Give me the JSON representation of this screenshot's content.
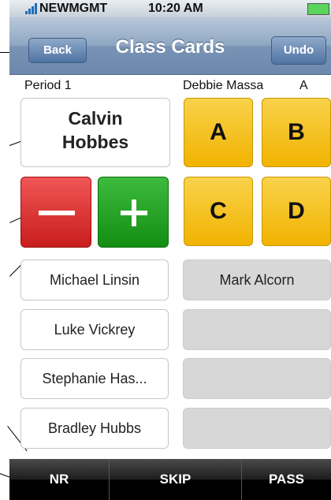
{
  "status_bar": {
    "carrier": "NEWMGMT",
    "time": "10:20 AM"
  },
  "nav": {
    "back_label": "Back",
    "title": "Class Cards",
    "undo_label": "Undo"
  },
  "labels": {
    "period": "Period 1",
    "student_right": "Debbie Massa",
    "grade": "A"
  },
  "current_student": {
    "first": "Calvin",
    "last": "Hobbes"
  },
  "answers": [
    "A",
    "B",
    "C",
    "D"
  ],
  "student_list": {
    "left": [
      "Michael Linsin",
      "Luke Vickrey",
      "Stephanie Has...",
      "Bradley Hubbs"
    ],
    "right": [
      "Mark Alcorn",
      "",
      "",
      ""
    ]
  },
  "tabs": [
    "NR",
    "SKIP",
    "PASS"
  ],
  "colors": {
    "answer_yellow": "#f1b300",
    "minus_red": "#c81d1d",
    "plus_green": "#138e13",
    "nav_blue": "#6c88ac"
  }
}
